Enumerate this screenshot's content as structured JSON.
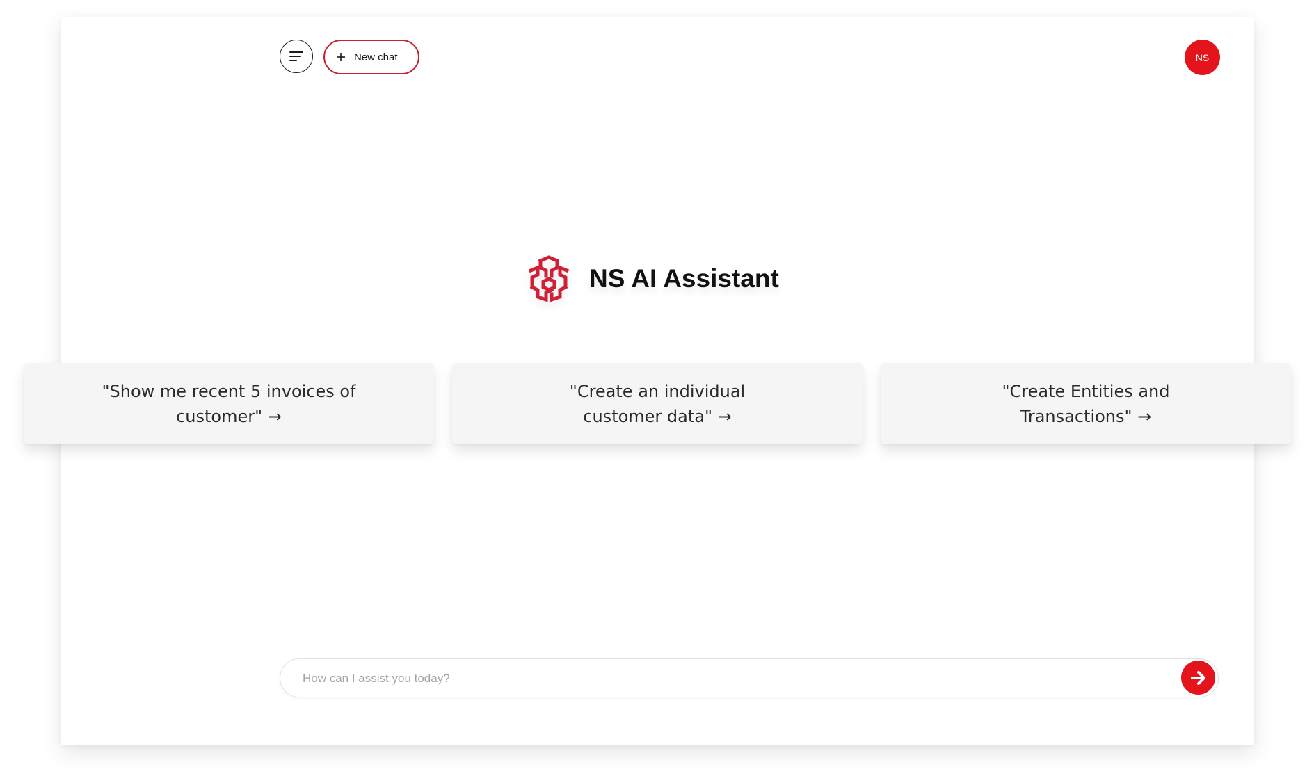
{
  "header": {
    "menu_icon": "menu-lines-icon",
    "new_chat_icon": "plus-icon",
    "new_chat_label": "New chat",
    "avatar_initials": "NS"
  },
  "brand": {
    "logo_icon": "brain-logo-icon",
    "title": "NS AI Assistant"
  },
  "suggestions": [
    {
      "label": "\"Show me recent 5 invoices of customer\" →"
    },
    {
      "label": "\"Create an individual customer data\" →"
    },
    {
      "label": "\"Create Entities and Transactions\" →"
    }
  ],
  "composer": {
    "placeholder": "How can I assist you today?",
    "value": "",
    "send_icon": "arrow-right-icon"
  },
  "colors": {
    "accent": "#e3141b",
    "accent_dark": "#c8202f",
    "card_bg": "#f5f5f5",
    "text": "#1a1a1a"
  }
}
